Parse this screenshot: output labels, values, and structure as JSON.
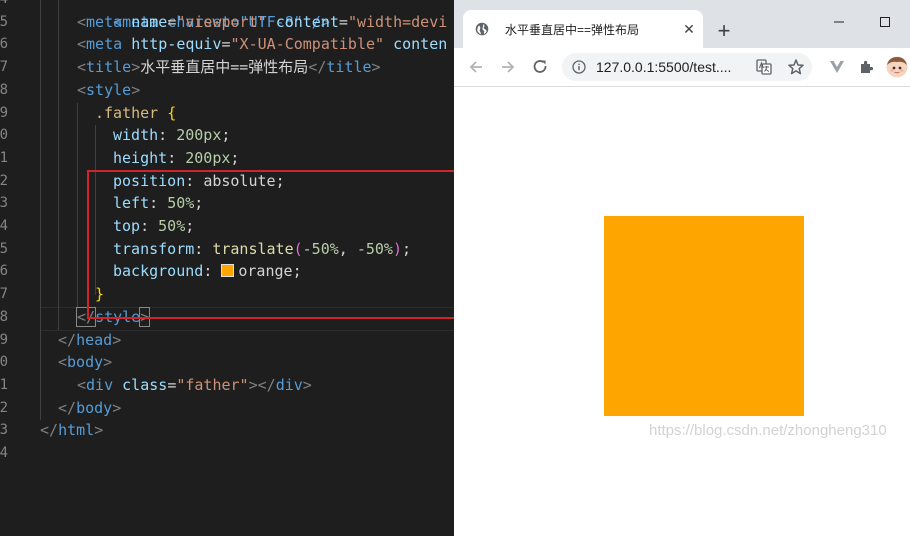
{
  "editor": {
    "line_numbers": [
      "4",
      "5",
      "6",
      "7",
      "8",
      "9",
      "0",
      "1",
      "2",
      "3",
      "4",
      "5",
      "6",
      "7",
      "8",
      "9",
      "0",
      "1",
      "2",
      "3",
      "4"
    ],
    "lines": [
      {
        "k": "meta_charset",
        "text": "<meta charset=\"UTF-8\" />"
      },
      {
        "k": "meta_viewport",
        "tag_open": "<",
        "tag": "meta",
        "attr": "name",
        "eq": "=",
        "val": "\"viewport\"",
        "attr2": "content",
        "eq2": "=",
        "val2": "\"width=devi"
      },
      {
        "k": "meta_compat",
        "tag_open": "<",
        "tag": "meta",
        "attr": "http-equiv",
        "eq": "=",
        "val": "\"X-UA-Compatible\"",
        "attr2": "conten"
      },
      {
        "k": "title",
        "open": "<",
        "tag": "title",
        "close": ">",
        "text": "水平垂直居中==弹性布局",
        "end_open": "</",
        "end_tag": "title",
        "end_close": ">"
      },
      {
        "k": "style_open",
        "open": "<",
        "tag": "style",
        "close": ">"
      },
      {
        "k": "selector",
        "selector": ".father",
        "brace": "{"
      },
      {
        "k": "width",
        "prop": "width",
        "colon": ":",
        "value": "200px",
        "semi": ";"
      },
      {
        "k": "height",
        "prop": "height",
        "colon": ":",
        "value": "200px",
        "semi": ";"
      },
      {
        "k": "position",
        "prop": "position",
        "colon": ":",
        "value": "absolute",
        "semi": ";"
      },
      {
        "k": "left",
        "prop": "left",
        "colon": ":",
        "value": "50%",
        "semi": ";"
      },
      {
        "k": "top",
        "prop": "top",
        "colon": ":",
        "value": "50%",
        "semi": ";"
      },
      {
        "k": "transform",
        "prop": "transform",
        "colon": ":",
        "fn": "translate",
        "p_open": "(",
        "a1": "-50%",
        "comma": ",",
        "a2": "-50%",
        "p_close": ")",
        "semi": ";"
      },
      {
        "k": "background",
        "prop": "background",
        "colon": ":",
        "value": "orange",
        "semi": ";"
      },
      {
        "k": "brace_close",
        "brace": "}"
      },
      {
        "k": "style_close",
        "open": "</",
        "tag": "style",
        "close": ">"
      },
      {
        "k": "head_close",
        "open": "</",
        "tag": "head",
        "close": ">"
      },
      {
        "k": "body_open",
        "open": "<",
        "tag": "body",
        "close": ">"
      },
      {
        "k": "div",
        "open": "<",
        "tag": "div",
        "attr": "class",
        "eq": "=",
        "val": "\"father\"",
        "close": ">",
        "end_open": "</",
        "end_tag": "div",
        "end_close": ">"
      },
      {
        "k": "body_close",
        "open": "</",
        "tag": "body",
        "close": ">"
      },
      {
        "k": "html_close",
        "open": "</",
        "tag": "html",
        "close": ">"
      }
    ]
  },
  "browser": {
    "tab_title": "水平垂直居中==弹性布局",
    "tab_close_glyph": "✕",
    "new_tab_glyph": "+",
    "url": "127.0.0.1:5500/test....",
    "box_color": "#ffa500",
    "icons": [
      "globe-icon",
      "close-icon",
      "plus-icon",
      "minimize-icon",
      "maximize-icon",
      "back-icon",
      "forward-icon",
      "reload-icon",
      "info-icon",
      "translate-icon",
      "star-icon",
      "vue-devtools-icon",
      "extensions-icon",
      "avatar"
    ]
  },
  "watermark": "https://blog.csdn.net/zhongheng310"
}
